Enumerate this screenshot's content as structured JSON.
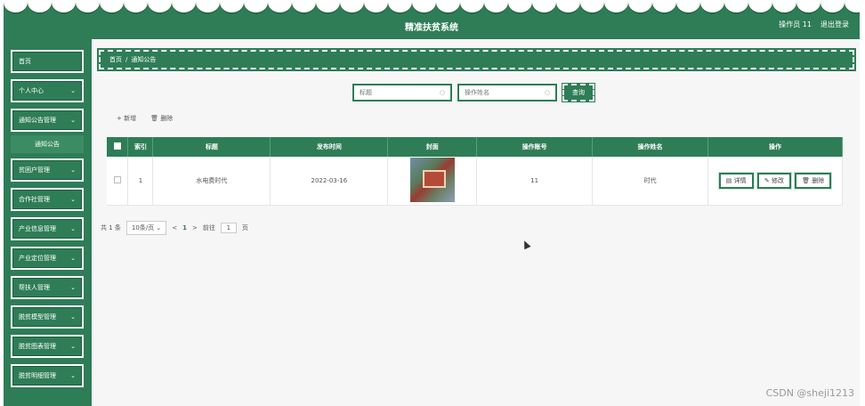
{
  "header": {
    "title": "精准扶贫系统",
    "user": "操作员 11",
    "logout": "退出登录"
  },
  "sidebar": {
    "items": [
      {
        "label": "首页",
        "has_chevron": false
      },
      {
        "label": "个人中心",
        "has_chevron": true
      },
      {
        "label": "通知公告管理",
        "has_chevron": true
      },
      {
        "label": "通知公告",
        "sub": true
      },
      {
        "label": "贫困户管理",
        "has_chevron": true
      },
      {
        "label": "合作社管理",
        "has_chevron": true
      },
      {
        "label": "产业信息管理",
        "has_chevron": true
      },
      {
        "label": "产业定位管理",
        "has_chevron": true
      },
      {
        "label": "帮扶人管理",
        "has_chevron": true
      },
      {
        "label": "脱贫模型管理",
        "has_chevron": true
      },
      {
        "label": "脱贫图表管理",
        "has_chevron": true
      },
      {
        "label": "脱贫明细管理",
        "has_chevron": true
      }
    ]
  },
  "breadcrumb": {
    "home": "首页",
    "sep": "/",
    "current": "通知公告"
  },
  "search": {
    "title_placeholder": "标题",
    "operator_placeholder": "操作姓名",
    "query_label": "查询"
  },
  "toolbar": {
    "add": "+ 新增",
    "delete": "🗑 删除"
  },
  "table": {
    "headers": [
      "",
      "索引",
      "标题",
      "发布时间",
      "封面",
      "操作账号",
      "操作姓名",
      "操作"
    ],
    "rows": [
      {
        "index": "1",
        "title": "水电费时代",
        "date": "2022-03-16",
        "account": "11",
        "name": "时代"
      }
    ],
    "op_labels": {
      "detail": "详情",
      "edit": "修改",
      "delete": "删除"
    }
  },
  "pager": {
    "total": "共 1 条",
    "page_size": "10条/页",
    "prev": "<",
    "current": "1",
    "next": ">",
    "goto_label": "前往",
    "goto_value": "1",
    "page_suffix": "页"
  },
  "watermark": "CSDN @sheji1213",
  "colors": {
    "primary": "#2e7d57"
  }
}
